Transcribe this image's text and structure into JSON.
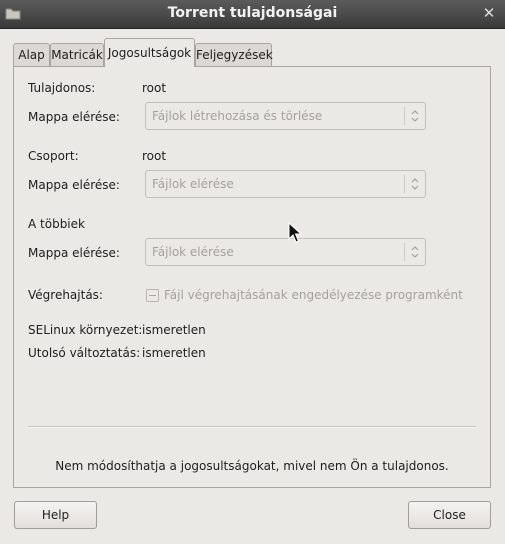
{
  "window": {
    "title": "Torrent tulajdonságai",
    "close_glyph": "✕"
  },
  "tabs": [
    {
      "label": "Alap",
      "active": false
    },
    {
      "label": "Matricák",
      "active": false
    },
    {
      "label": "Jogosultságok",
      "active": true
    },
    {
      "label": "Feljegyzések",
      "active": false
    }
  ],
  "owner": {
    "label": "Tulajdonos:",
    "value": "root",
    "access_label": "Mappa elérése:",
    "access_value": "Fájlok létrehozása és törlése"
  },
  "group": {
    "label": "Csoport:",
    "value": "root",
    "access_label": "Mappa elérése:",
    "access_value": "Fájlok elérése"
  },
  "others": {
    "label": "A többiek",
    "access_label": "Mappa elérése:",
    "access_value": "Fájlok elérése"
  },
  "execute": {
    "label": "Végrehajtás:",
    "checkbox_label": "Fájl végrehajtásának engedélyezése programként",
    "checkbox_state": "inconsistent"
  },
  "selinux": {
    "label": "SELinux környezet:",
    "value": "ismeretlen"
  },
  "last_changed": {
    "label": "Utolsó változtatás:",
    "value": "ismeretlen"
  },
  "notice": "Nem módosíthatja a jogosultságokat, mivel nem Ön a tulajdonos.",
  "buttons": {
    "help": "Help",
    "close": "Close"
  },
  "icons": {
    "window": "folder-icon",
    "combo_arrow": "up-down-arrows-icon",
    "pointer": "mouse-pointer-icon"
  }
}
